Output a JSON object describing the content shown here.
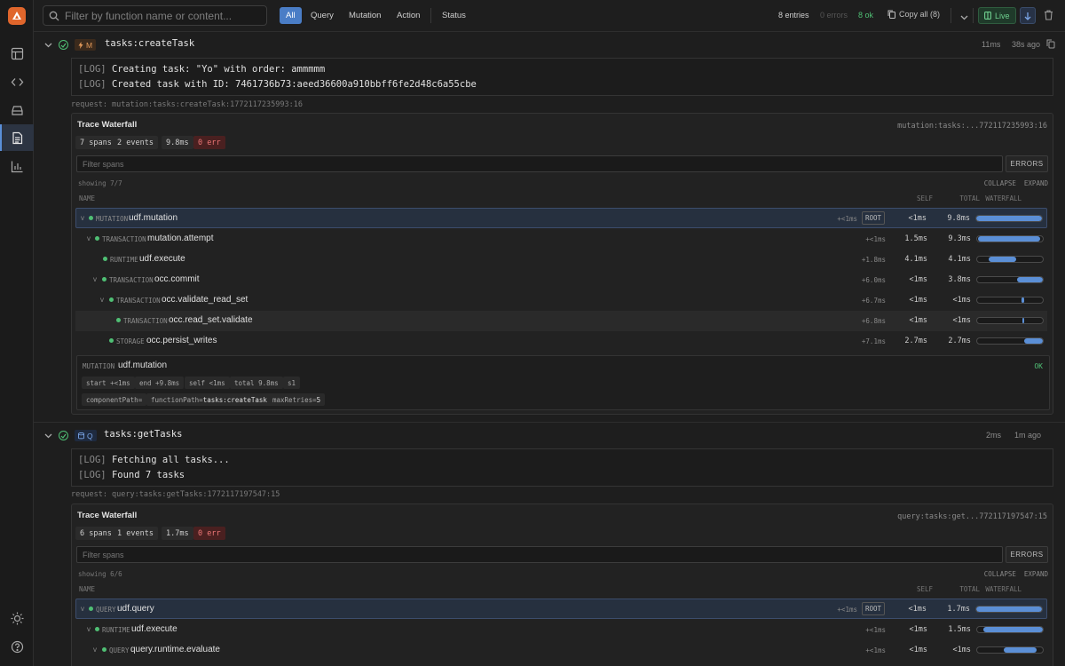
{
  "search": {
    "placeholder": "Filter by function name or content..."
  },
  "filters": [
    "All",
    "Query",
    "Mutation",
    "Action",
    "Status"
  ],
  "status": {
    "entries": "8 entries",
    "errors": "0 errors",
    "ok": "8 ok",
    "copy": "Copy all (8)",
    "live": "Live"
  },
  "colors": {
    "accent": "#4a7dc6",
    "ok": "#4fbf74",
    "mutation": "#e39a5b",
    "error": "#e77777"
  },
  "sidebar": {
    "icons": [
      "table-icon",
      "code-icon",
      "storage-icon",
      "logs-icon",
      "chart-icon",
      "sun-icon",
      "help-icon"
    ]
  },
  "entries": [
    {
      "type_letter": "M",
      "name": "tasks:createTask",
      "duration": "11ms",
      "ago": "38s ago",
      "logs": [
        {
          "tag": "[LOG]",
          "text": "Creating task: \"Yo\" with order: ammmmm"
        },
        {
          "tag": "[LOG]",
          "text": "Created task with ID: 7461736b73:aeed36600a910bbff6fe2d48c6a55cbe"
        }
      ],
      "request": "request: mutation:tasks:createTask:1772117235993:16",
      "trace": {
        "title": "Trace Waterfall",
        "req_short": "mutation:tasks:...772117235993:16",
        "chips": [
          "7 spans",
          "2 events",
          "9.8ms",
          "0 err"
        ],
        "filter_placeholder": "Filter spans",
        "errors_btn": "ERRORS",
        "showing": "showing 7/7",
        "collapse": "COLLAPSE",
        "expand": "EXPAND",
        "headers": {
          "name": "NAME",
          "self": "SELF",
          "total": "TOTAL",
          "waterfall": "WATERFALL"
        },
        "spans": [
          {
            "chev": "v",
            "kind": "MUTATION",
            "name": "udf.mutation",
            "offset": "+<1ms",
            "root": "ROOT",
            "self": "<1ms",
            "total": "9.8ms",
            "bar_start": 0.0,
            "bar_width": 1.0
          },
          {
            "chev": "v",
            "kind": "TRANSACTION",
            "name": "mutation.attempt",
            "offset": "+<1ms",
            "self": "1.5ms",
            "total": "9.3ms",
            "bar_start": 0.01,
            "bar_width": 0.95
          },
          {
            "chev": "",
            "kind": "RUNTIME",
            "name": "udf.execute",
            "offset": "+1.8ms",
            "self": "4.1ms",
            "total": "4.1ms",
            "bar_start": 0.18,
            "bar_width": 0.42
          },
          {
            "chev": "v",
            "kind": "TRANSACTION",
            "name": "occ.commit",
            "offset": "+6.0ms",
            "self": "<1ms",
            "total": "3.8ms",
            "bar_start": 0.61,
            "bar_width": 0.39
          },
          {
            "chev": "v",
            "kind": "TRANSACTION",
            "name": "occ.validate_read_set",
            "offset": "+6.7ms",
            "self": "<1ms",
            "total": "<1ms",
            "bar_start": 0.68,
            "bar_width": 0.03
          },
          {
            "chev": "",
            "kind": "TRANSACTION",
            "name": "occ.read_set.validate",
            "offset": "+6.8ms",
            "self": "<1ms",
            "total": "<1ms",
            "bar_start": 0.69,
            "bar_width": 0.02
          },
          {
            "chev": "",
            "kind": "STORAGE",
            "name": "occ.persist_writes",
            "offset": "+7.1ms",
            "self": "2.7ms",
            "total": "2.7ms",
            "bar_start": 0.72,
            "bar_width": 0.28
          }
        ],
        "detail": {
          "kind": "MUTATION",
          "name": "udf.mutation",
          "status": "OK",
          "chips1": [
            "start +<1ms",
            "end +9.8ms",
            "self <1ms",
            "total 9.8ms",
            "s1"
          ],
          "chips2": [
            {
              "key": "componentPath=",
              "val": ""
            },
            {
              "key": "functionPath=",
              "val": "tasks:createTask"
            },
            {
              "key": "maxRetries=",
              "val": "5"
            }
          ]
        }
      }
    },
    {
      "type_letter": "Q",
      "name": "tasks:getTasks",
      "duration": "2ms",
      "ago": "1m ago",
      "logs": [
        {
          "tag": "[LOG]",
          "text": "Fetching all tasks..."
        },
        {
          "tag": "[LOG]",
          "text": "Found 7 tasks"
        }
      ],
      "request": "request: query:tasks:getTasks:1772117197547:15",
      "trace": {
        "title": "Trace Waterfall",
        "req_short": "query:tasks:get...772117197547:15",
        "chips": [
          "6 spans",
          "1 events",
          "1.7ms",
          "0 err"
        ],
        "filter_placeholder": "Filter spans",
        "errors_btn": "ERRORS",
        "showing": "showing 6/6",
        "collapse": "COLLAPSE",
        "expand": "EXPAND",
        "headers": {
          "name": "NAME",
          "self": "SELF",
          "total": "TOTAL",
          "waterfall": "WATERFALL"
        },
        "spans": [
          {
            "chev": "v",
            "kind": "QUERY",
            "name": "udf.query",
            "offset": "+<1ms",
            "root": "ROOT",
            "self": "<1ms",
            "total": "1.7ms",
            "bar_start": 0.0,
            "bar_width": 1.0
          },
          {
            "chev": "v",
            "kind": "RUNTIME",
            "name": "udf.execute",
            "offset": "+<1ms",
            "self": "<1ms",
            "total": "1.5ms",
            "bar_start": 0.1,
            "bar_width": 0.9
          },
          {
            "chev": "v",
            "kind": "QUERY",
            "name": "query.runtime.evaluate",
            "offset": "+<1ms",
            "self": "<1ms",
            "total": "<1ms",
            "bar_start": 0.4,
            "bar_width": 0.5
          }
        ]
      }
    }
  ]
}
